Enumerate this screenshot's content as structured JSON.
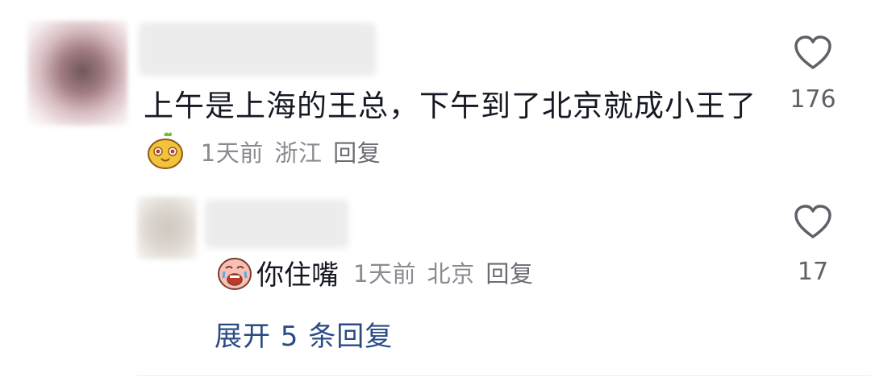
{
  "comment": {
    "text": "上午是上海的王总，下午到了北京就成小王了",
    "time": "1天前",
    "location": "浙江",
    "reply_label": "回复",
    "emoji": "smiling-cartoon-emoji",
    "likes": "176"
  },
  "reply": {
    "text": "你住嘴",
    "time": "1天前",
    "location": "北京",
    "reply_label": "回复",
    "emoji": "crying-cartoon-emoji",
    "likes": "17"
  },
  "expand_label": "展开 5 条回复",
  "colors": {
    "text": "#161823",
    "meta": "#8a8b91",
    "link": "#2a4a86",
    "icon": "#5f6068"
  }
}
